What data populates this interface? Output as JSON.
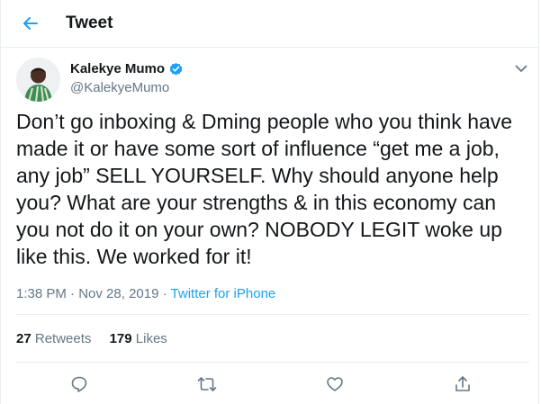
{
  "header": {
    "title": "Tweet",
    "back_icon": "arrow-left-icon"
  },
  "tweet": {
    "author": {
      "name": "Kalekye Mumo",
      "handle": "@KalekyeMumo",
      "verified": true
    },
    "text": "Don’t go inboxing & Dming people who you think have made it or have some sort of influence “get me a job, any job” SELL YOURSELF. Why should anyone help you? What are your strengths & in this economy can you not do it on your own? NOBODY LEGIT woke up like this. We worked for it!",
    "time": "1:38 PM",
    "separator": "·",
    "date": "Nov 28, 2019",
    "source": "Twitter for iPhone",
    "stats": {
      "retweets_count": "27",
      "retweets_label": "Retweets",
      "likes_count": "179",
      "likes_label": "Likes"
    }
  },
  "colors": {
    "accent": "#1da1f2",
    "secondary_text": "#657786",
    "divider": "#e6ecf0"
  },
  "actions": [
    "reply-icon",
    "retweet-icon",
    "like-icon",
    "share-icon"
  ]
}
